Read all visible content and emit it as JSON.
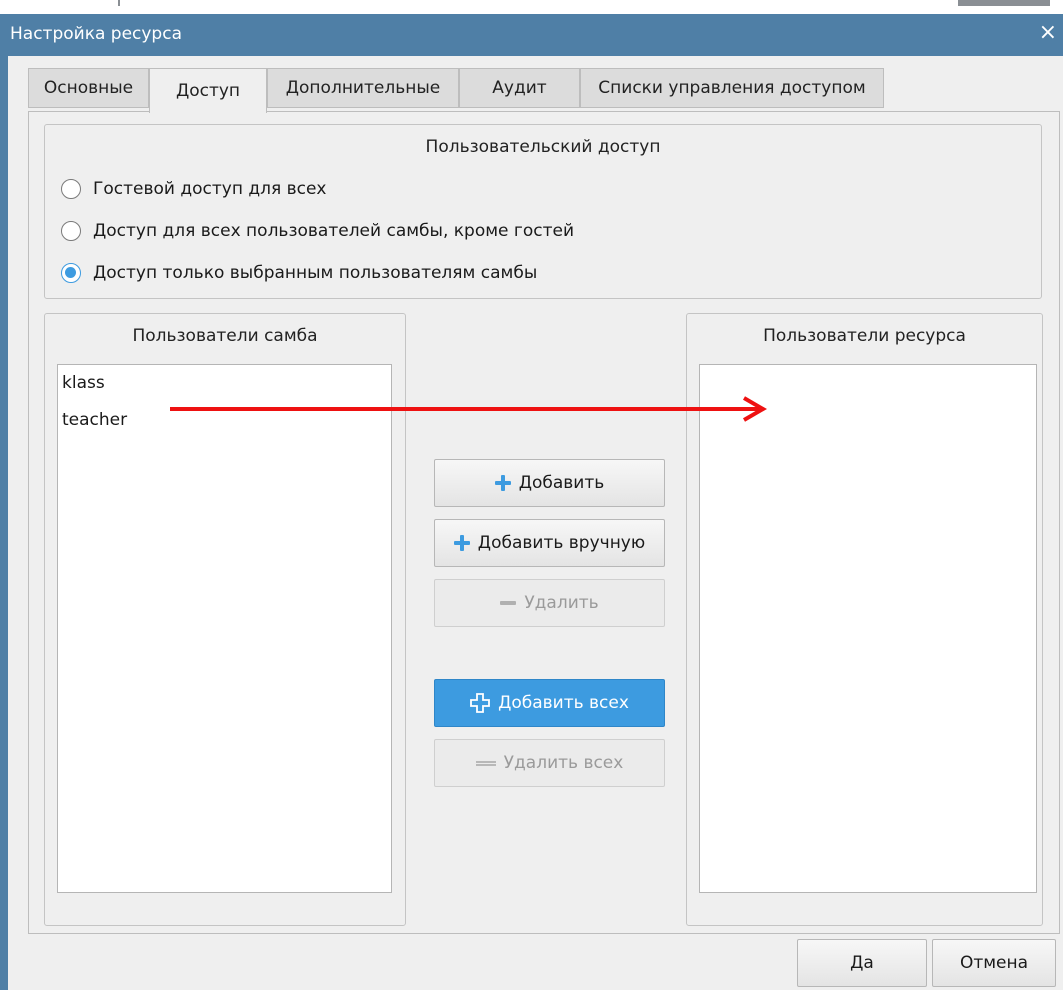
{
  "window": {
    "title": "Настройка ресурса",
    "close_glyph": "×"
  },
  "tabs": [
    {
      "label": "Основные",
      "active": false
    },
    {
      "label": "Доступ",
      "active": true
    },
    {
      "label": "Дополнительные",
      "active": false
    },
    {
      "label": "Аудит",
      "active": false
    },
    {
      "label": "Списки управления доступом",
      "active": false
    }
  ],
  "user_access": {
    "title": "Пользовательский доступ",
    "options": [
      {
        "label": "Гостевой доступ для всех",
        "checked": false
      },
      {
        "label": "Доступ для всех пользователей самбы, кроме гостей",
        "checked": false
      },
      {
        "label": "Доступ только выбранным пользователям самбы",
        "checked": true
      }
    ]
  },
  "samba_users": {
    "title": "Пользователи самба",
    "items": [
      "klass",
      "teacher"
    ]
  },
  "resource_users": {
    "title": "Пользователи ресурса",
    "items": []
  },
  "actions": {
    "add": "Добавить",
    "add_manual": "Добавить вручную",
    "remove": "Удалить",
    "add_all": "Добавить всех",
    "remove_all": "Удалить всех"
  },
  "footer": {
    "ok": "Да",
    "cancel": "Отмена"
  },
  "colors": {
    "titlebar": "#4f7fa6",
    "accent": "#3d9be0",
    "annotation_arrow": "#ee1111"
  },
  "icons": {
    "add": "plus-icon",
    "remove": "minus-icon",
    "add_all": "outline-plus-icon",
    "remove_all": "double-minus-icon",
    "close": "close-icon"
  }
}
